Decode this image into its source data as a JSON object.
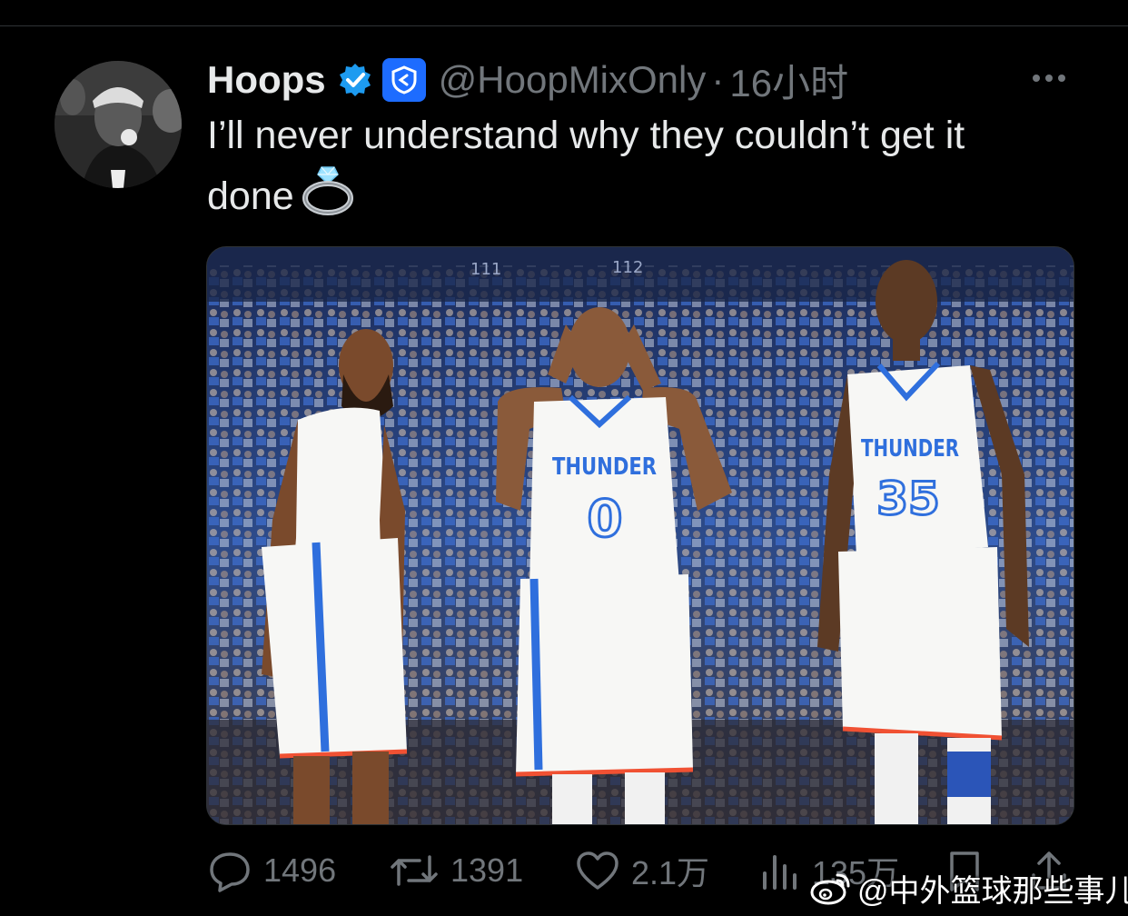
{
  "tweet": {
    "display_name": "Hoops",
    "handle": "@HoopMixOnly",
    "separator": "·",
    "time": "16小时",
    "text_line1": "I’ll never understand why they couldn’t get it",
    "text_line2": "done",
    "emoji": "ring-emoji"
  },
  "media": {
    "jersey_team": "THUNDER",
    "numbers": [
      "0",
      "35"
    ],
    "banner_numbers": [
      "111",
      "112"
    ]
  },
  "actions": {
    "replies": "1496",
    "retweets": "1391",
    "likes": "2.1万",
    "views": "135万"
  },
  "watermark": {
    "text": "@中外篮球那些事儿"
  },
  "colors": {
    "background": "#000000",
    "primary_text": "#e7e9ea",
    "secondary_text": "#71767b",
    "verified_blue": "#1d9bf0",
    "affiliate_blue": "#1d6cff",
    "thunder_blue": "#2f6fdd",
    "thunder_orange": "#f05133"
  }
}
